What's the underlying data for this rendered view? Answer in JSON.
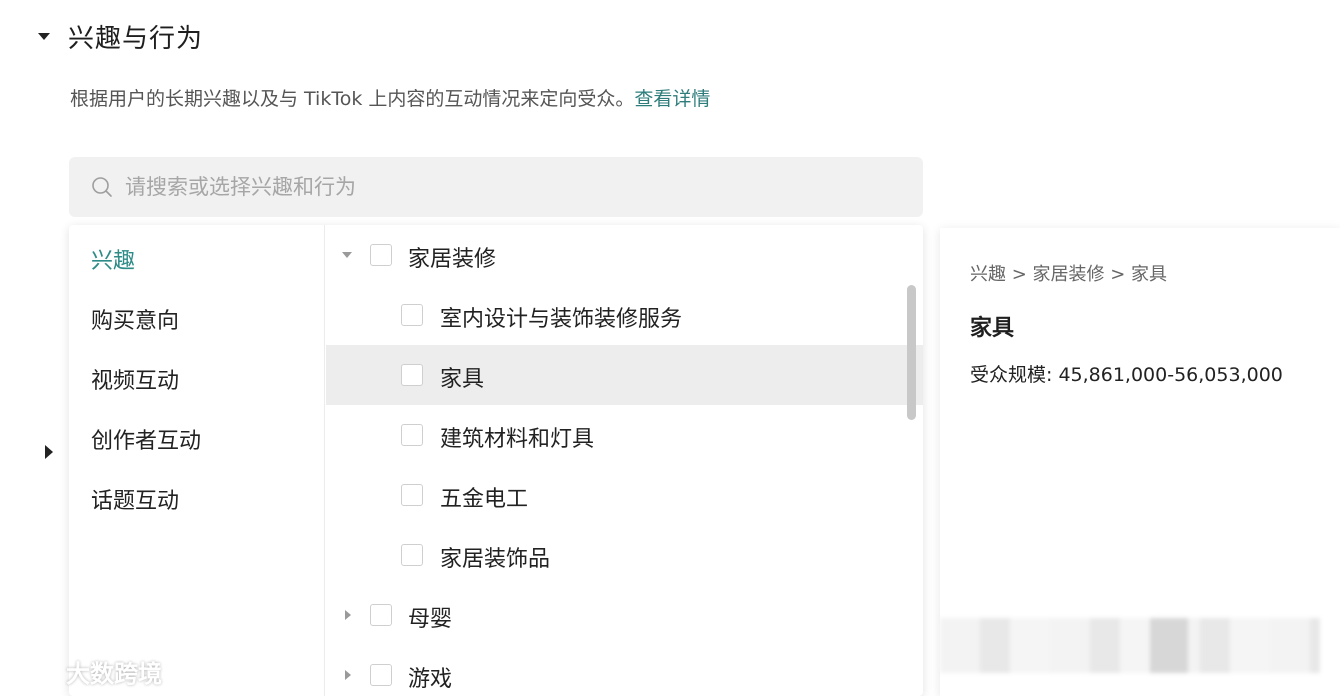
{
  "section": {
    "title": "兴趣与行为"
  },
  "description": {
    "text": "根据用户的长期兴趣以及与 TikTok 上内容的互动情况来定向受众。",
    "link": "查看详情"
  },
  "search": {
    "placeholder": "请搜索或选择兴趣和行为",
    "value": ""
  },
  "categories": [
    {
      "label": "兴趣",
      "active": true
    },
    {
      "label": "购买意向",
      "active": false
    },
    {
      "label": "视频互动",
      "active": false
    },
    {
      "label": "创作者互动",
      "active": false
    },
    {
      "label": "话题互动",
      "active": false
    }
  ],
  "tree": {
    "parent_expanded": {
      "label": "家居装修",
      "checked": false
    },
    "children": [
      {
        "label": "室内设计与装饰装修服务",
        "checked": false
      },
      {
        "label": "家具",
        "checked": false,
        "highlighted": true
      },
      {
        "label": "建筑材料和灯具",
        "checked": false
      },
      {
        "label": "五金电工",
        "checked": false
      },
      {
        "label": "家居装饰品",
        "checked": false
      }
    ],
    "collapsed": [
      {
        "label": "母婴",
        "checked": false
      },
      {
        "label": "游戏",
        "checked": false
      }
    ]
  },
  "detail": {
    "breadcrumb": "兴趣 > 家居装修 > 家具",
    "title": "家具",
    "audience": "受众规模: 45,861,000-56,053,000"
  },
  "watermark": {
    "text": "大数跨境"
  },
  "colors": {
    "accent": "#2e8b87",
    "link": "#2e7d7b",
    "highlight_row": "#ededee"
  },
  "icons": [
    "search-icon",
    "caret-down-icon",
    "caret-right-icon",
    "expand-arrow-icon",
    "logo-icon"
  ]
}
